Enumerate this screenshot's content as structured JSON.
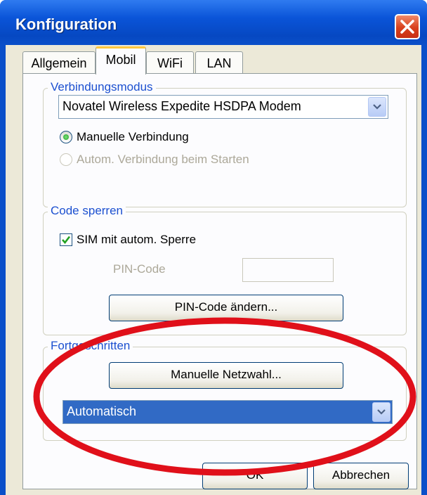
{
  "window": {
    "title": "Konfiguration"
  },
  "tabs": [
    {
      "label": "Allgemein"
    },
    {
      "label": "Mobil"
    },
    {
      "label": "WiFi"
    },
    {
      "label": "LAN"
    }
  ],
  "verbindungsmodus": {
    "legend": "Verbindungsmodus",
    "device": "Novatel Wireless Expedite HSDPA Modem",
    "radio_manual": "Manuelle Verbindung",
    "radio_auto": "Autom. Verbindung beim Starten"
  },
  "code_sperren": {
    "legend": "Code sperren",
    "checkbox_label": "SIM mit autom. Sperre",
    "pin_label": "PIN-Code",
    "pin_value": "",
    "change_button": "PIN-Code ändern..."
  },
  "fortgeschritten": {
    "legend": "Fortgeschritten",
    "network_button": "Manuelle Netzwahl...",
    "network_select": "Automatisch"
  },
  "footer": {
    "ok": "OK",
    "cancel": "Abbrechen"
  },
  "colors": {
    "highlight_ellipse": "#e0101a",
    "selection": "#316ac5",
    "legend_text": "#1c50d0"
  }
}
